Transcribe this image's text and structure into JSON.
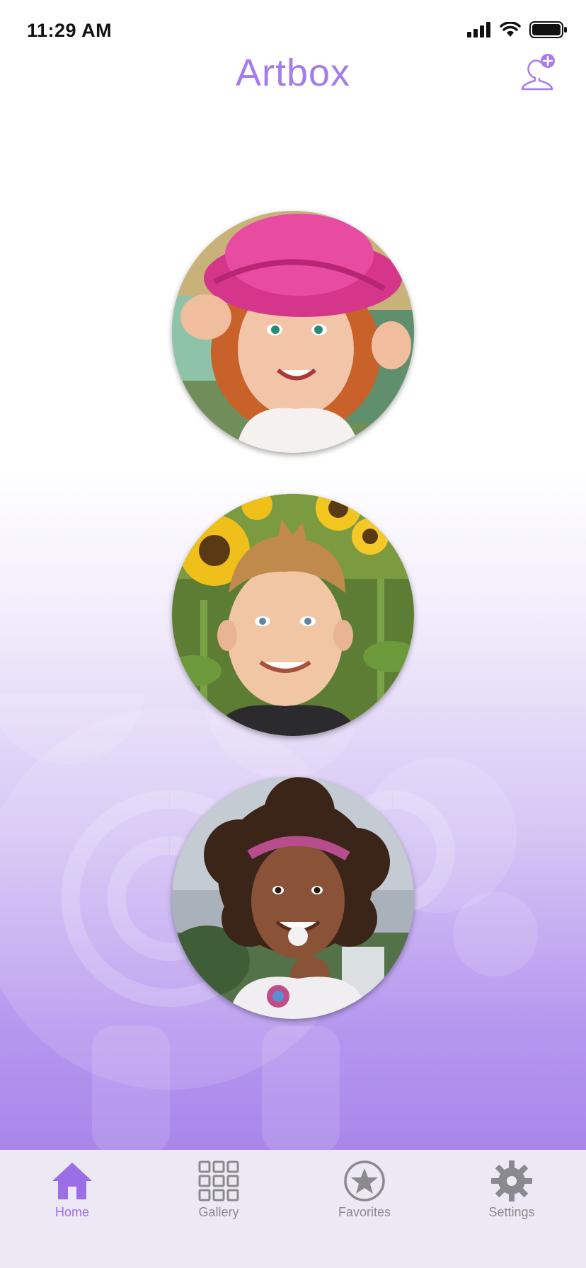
{
  "status_bar": {
    "time": "11:29 AM",
    "icons": [
      "signal-icon",
      "wifi-icon",
      "battery-icon"
    ]
  },
  "header": {
    "title": "Artbox",
    "add_profile_icon": "add-user-icon"
  },
  "profiles": [
    {
      "photo": "child-pink-hat-photo"
    },
    {
      "photo": "child-sunflowers-photo"
    },
    {
      "photo": "child-curly-hair-photo"
    }
  ],
  "tab_bar": {
    "tabs": [
      {
        "label": "Home",
        "icon": "home-icon",
        "active": true
      },
      {
        "label": "Gallery",
        "icon": "grid-icon",
        "active": false
      },
      {
        "label": "Favorites",
        "icon": "star-icon",
        "active": false
      },
      {
        "label": "Settings",
        "icon": "gear-icon",
        "active": false
      }
    ]
  },
  "colors": {
    "accent": "#9b6ee8",
    "title": "#a57cec",
    "tab_bar_bg": "#ede9f4",
    "inactive": "#8a8a8e"
  }
}
